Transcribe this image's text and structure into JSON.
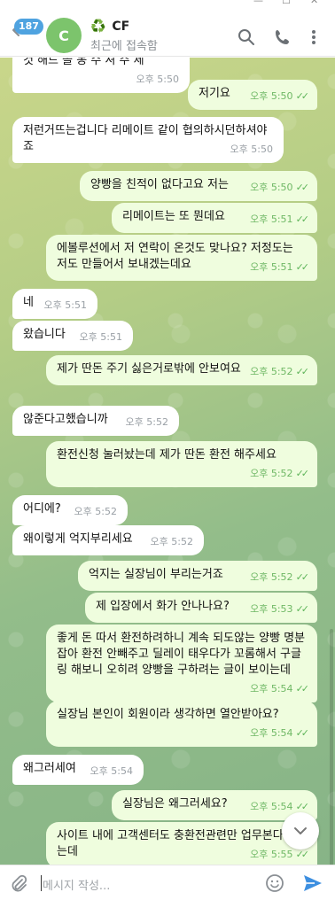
{
  "header": {
    "badge_count": "187",
    "avatar_letter": "C",
    "title_prefix": "♻️",
    "title": "CF",
    "status": "최근에 접속함"
  },
  "messages": [
    {
      "side": "in",
      "text": "것 해드 쓸 동 수 셔 주 세",
      "time": "오후 5:50"
    },
    {
      "side": "out",
      "text": "저기요",
      "time": "오후 5:50"
    },
    {
      "side": "in",
      "text": "저런거뜨는겁니다 리메이트 같이 협의하시던하셔야죠",
      "time": "오후 5:50"
    },
    {
      "side": "out",
      "text": "양빵을 친적이 없다고요 저는",
      "time": "오후 5:50"
    },
    {
      "side": "out",
      "text": "리메이트는 또 뭔데요",
      "time": "오후 5:51"
    },
    {
      "side": "out",
      "text": "에볼루션에서 저 연락이 온것도 맞나요? 저정도는 저도 만들어서 보내겠는데요",
      "time": "오후 5:51"
    },
    {
      "side": "in",
      "text": "네",
      "time": "오후 5:51"
    },
    {
      "side": "in",
      "text": "왔습니다",
      "time": "오후 5:51"
    },
    {
      "side": "out",
      "text": "제가 딴돈 주기 싫은거로밖에 안보여요",
      "time": "오후 5:52"
    },
    {
      "side": "in",
      "text": "않준다고했습니까",
      "time": "오후 5:52"
    },
    {
      "side": "out",
      "text": "환전신청 눌러놨는데 제가 딴돈 환전 해주세요",
      "time": "오후 5:52"
    },
    {
      "side": "in",
      "text": "어디에?",
      "time": "오후 5:52"
    },
    {
      "side": "in",
      "text": "왜이렇게 억지부리세요",
      "time": "오후 5:52"
    },
    {
      "side": "out",
      "text": "억지는 실장님이 부리는거죠",
      "time": "오후 5:52"
    },
    {
      "side": "out",
      "text": "제 입장에서 화가 안나나요?",
      "time": "오후 5:53"
    },
    {
      "side": "out",
      "text": "좋게 돈 따서 환전하려하니 계속 되도않는 양빵 명분잡아 환전 안빼주고 딜레이 태우다가 꼬롬해서 구글링 해보니 오히려 양빵을 구하려는 글이 보이는데",
      "time": "오후 5:54"
    },
    {
      "side": "out",
      "text": "실장님 본인이 회원이라 생각하면 열안받아요?",
      "time": "오후 5:54"
    },
    {
      "side": "in",
      "text": "왜그러세여",
      "time": "오후 5:54"
    },
    {
      "side": "out",
      "text": "실장님은 왜그러세요?",
      "time": "오후 5:54"
    },
    {
      "side": "out",
      "text": "사이트 내에 고객센터도 충환전관련만 업무본다 하는데",
      "time": "오후 5:55"
    }
  ],
  "input": {
    "placeholder": "메시지 작성..."
  },
  "colors": {
    "incoming_bubble": "#ffffff",
    "outgoing_bubble": "#effdde",
    "read_check": "#5fb55a",
    "badge": "#4fa3e0",
    "avatar": "#7cc46c",
    "send": "#3d8fe0"
  },
  "icons": [
    "back-arrow-icon",
    "search-icon",
    "phone-icon",
    "more-vertical-icon",
    "recycle-icon",
    "double-check-icon",
    "chevron-down-icon",
    "attach-icon",
    "emoji-icon",
    "send-icon"
  ]
}
